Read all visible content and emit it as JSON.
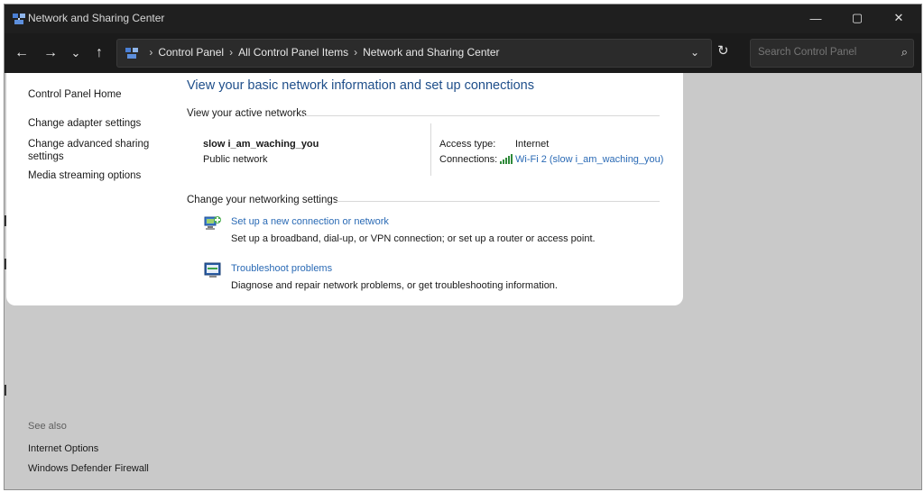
{
  "window": {
    "title": "Network and Sharing Center",
    "controls": {
      "minimize": "—",
      "maximize": "▢",
      "close": "✕"
    }
  },
  "nav": {
    "back": "←",
    "forward": "→",
    "recent": "⌄",
    "up": "↑"
  },
  "address": {
    "breadcrumbs": [
      "Control Panel",
      "All Control Panel Items",
      "Network and Sharing Center"
    ],
    "separator": "›",
    "dropdown": "⌄",
    "refresh": "↻"
  },
  "search": {
    "placeholder": "Search Control Panel",
    "icon": "search-icon"
  },
  "sidebar": {
    "home": "Control Panel Home",
    "items": [
      {
        "label": "Change adapter settings"
      },
      {
        "label": "Change advanced sharing\nsettings"
      },
      {
        "label": "Media streaming options"
      }
    ],
    "see_also": {
      "title": "See also",
      "items": [
        "Internet Options",
        "Windows Defender Firewall"
      ]
    }
  },
  "main": {
    "heading": "View your basic network information and set up connections",
    "active_networks": {
      "title": "View your active networks",
      "network_name": "slow i_am_waching_you",
      "network_type": "Public network",
      "access_type_label": "Access type:",
      "access_type_value": "Internet",
      "connections_label": "Connections:",
      "connections_value": "Wi-Fi 2 (slow i_am_waching_you)"
    },
    "networking_settings": {
      "title": "Change your networking settings",
      "items": [
        {
          "link": "Set up a new connection or network",
          "description": "Set up a broadband, dial-up, or VPN connection; or set up a router or access point.",
          "icon": "new-connection-icon"
        },
        {
          "link": "Troubleshoot problems",
          "description": "Diagnose and repair network problems, or get troubleshooting information.",
          "icon": "troubleshoot-icon"
        }
      ]
    }
  },
  "colors": {
    "heading": "#1e4e8a",
    "link": "#2a6ab5",
    "dark_chrome": "#1f1f1f",
    "dimmed_background": "#c9c9c9"
  }
}
